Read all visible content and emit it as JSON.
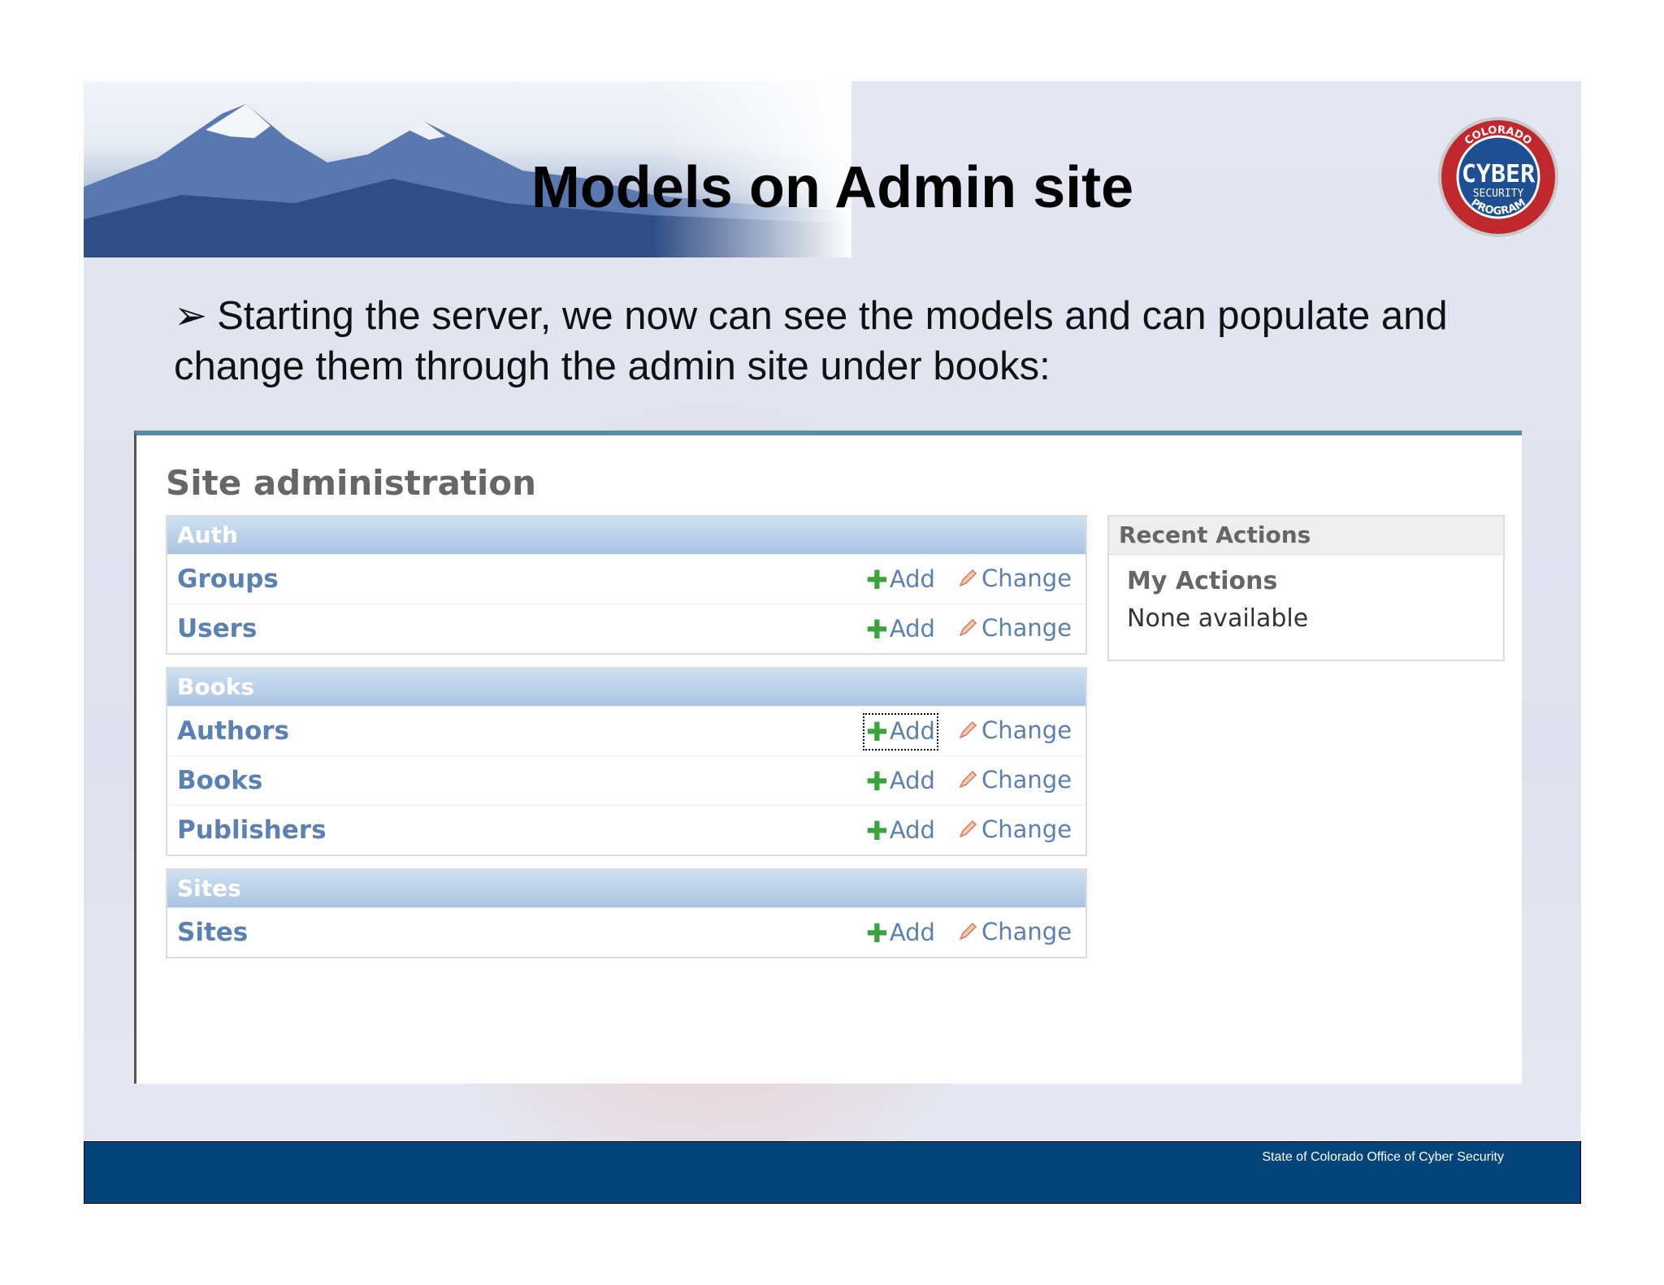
{
  "slide": {
    "title": "Models on Admin site",
    "bullet": "Starting the server, we now can see the models and can populate and change them through the admin site under books:",
    "footer": "State of Colorado Office of Cyber Security"
  },
  "logo": {
    "top_text": "COLORADO",
    "main_text": "CYBER",
    "sub_text": "SECURITY",
    "bottom_text": "PROGRAM"
  },
  "admin": {
    "title": "Site administration",
    "add_label": "Add",
    "change_label": "Change",
    "modules": [
      {
        "name": "Auth",
        "models": [
          "Groups",
          "Users"
        ]
      },
      {
        "name": "Books",
        "models": [
          "Authors",
          "Books",
          "Publishers"
        ]
      },
      {
        "name": "Sites",
        "models": [
          "Sites"
        ]
      }
    ],
    "recent": {
      "header": "Recent Actions",
      "subheader": "My Actions",
      "empty": "None available"
    }
  },
  "colors": {
    "footer_bar": "#03457a",
    "link": "#5b80b2",
    "module_header": "#a9c4e2",
    "add_icon": "#3ca23c"
  },
  "icons": [
    "plus-icon",
    "pencil-icon",
    "arrow-bullet-icon"
  ]
}
